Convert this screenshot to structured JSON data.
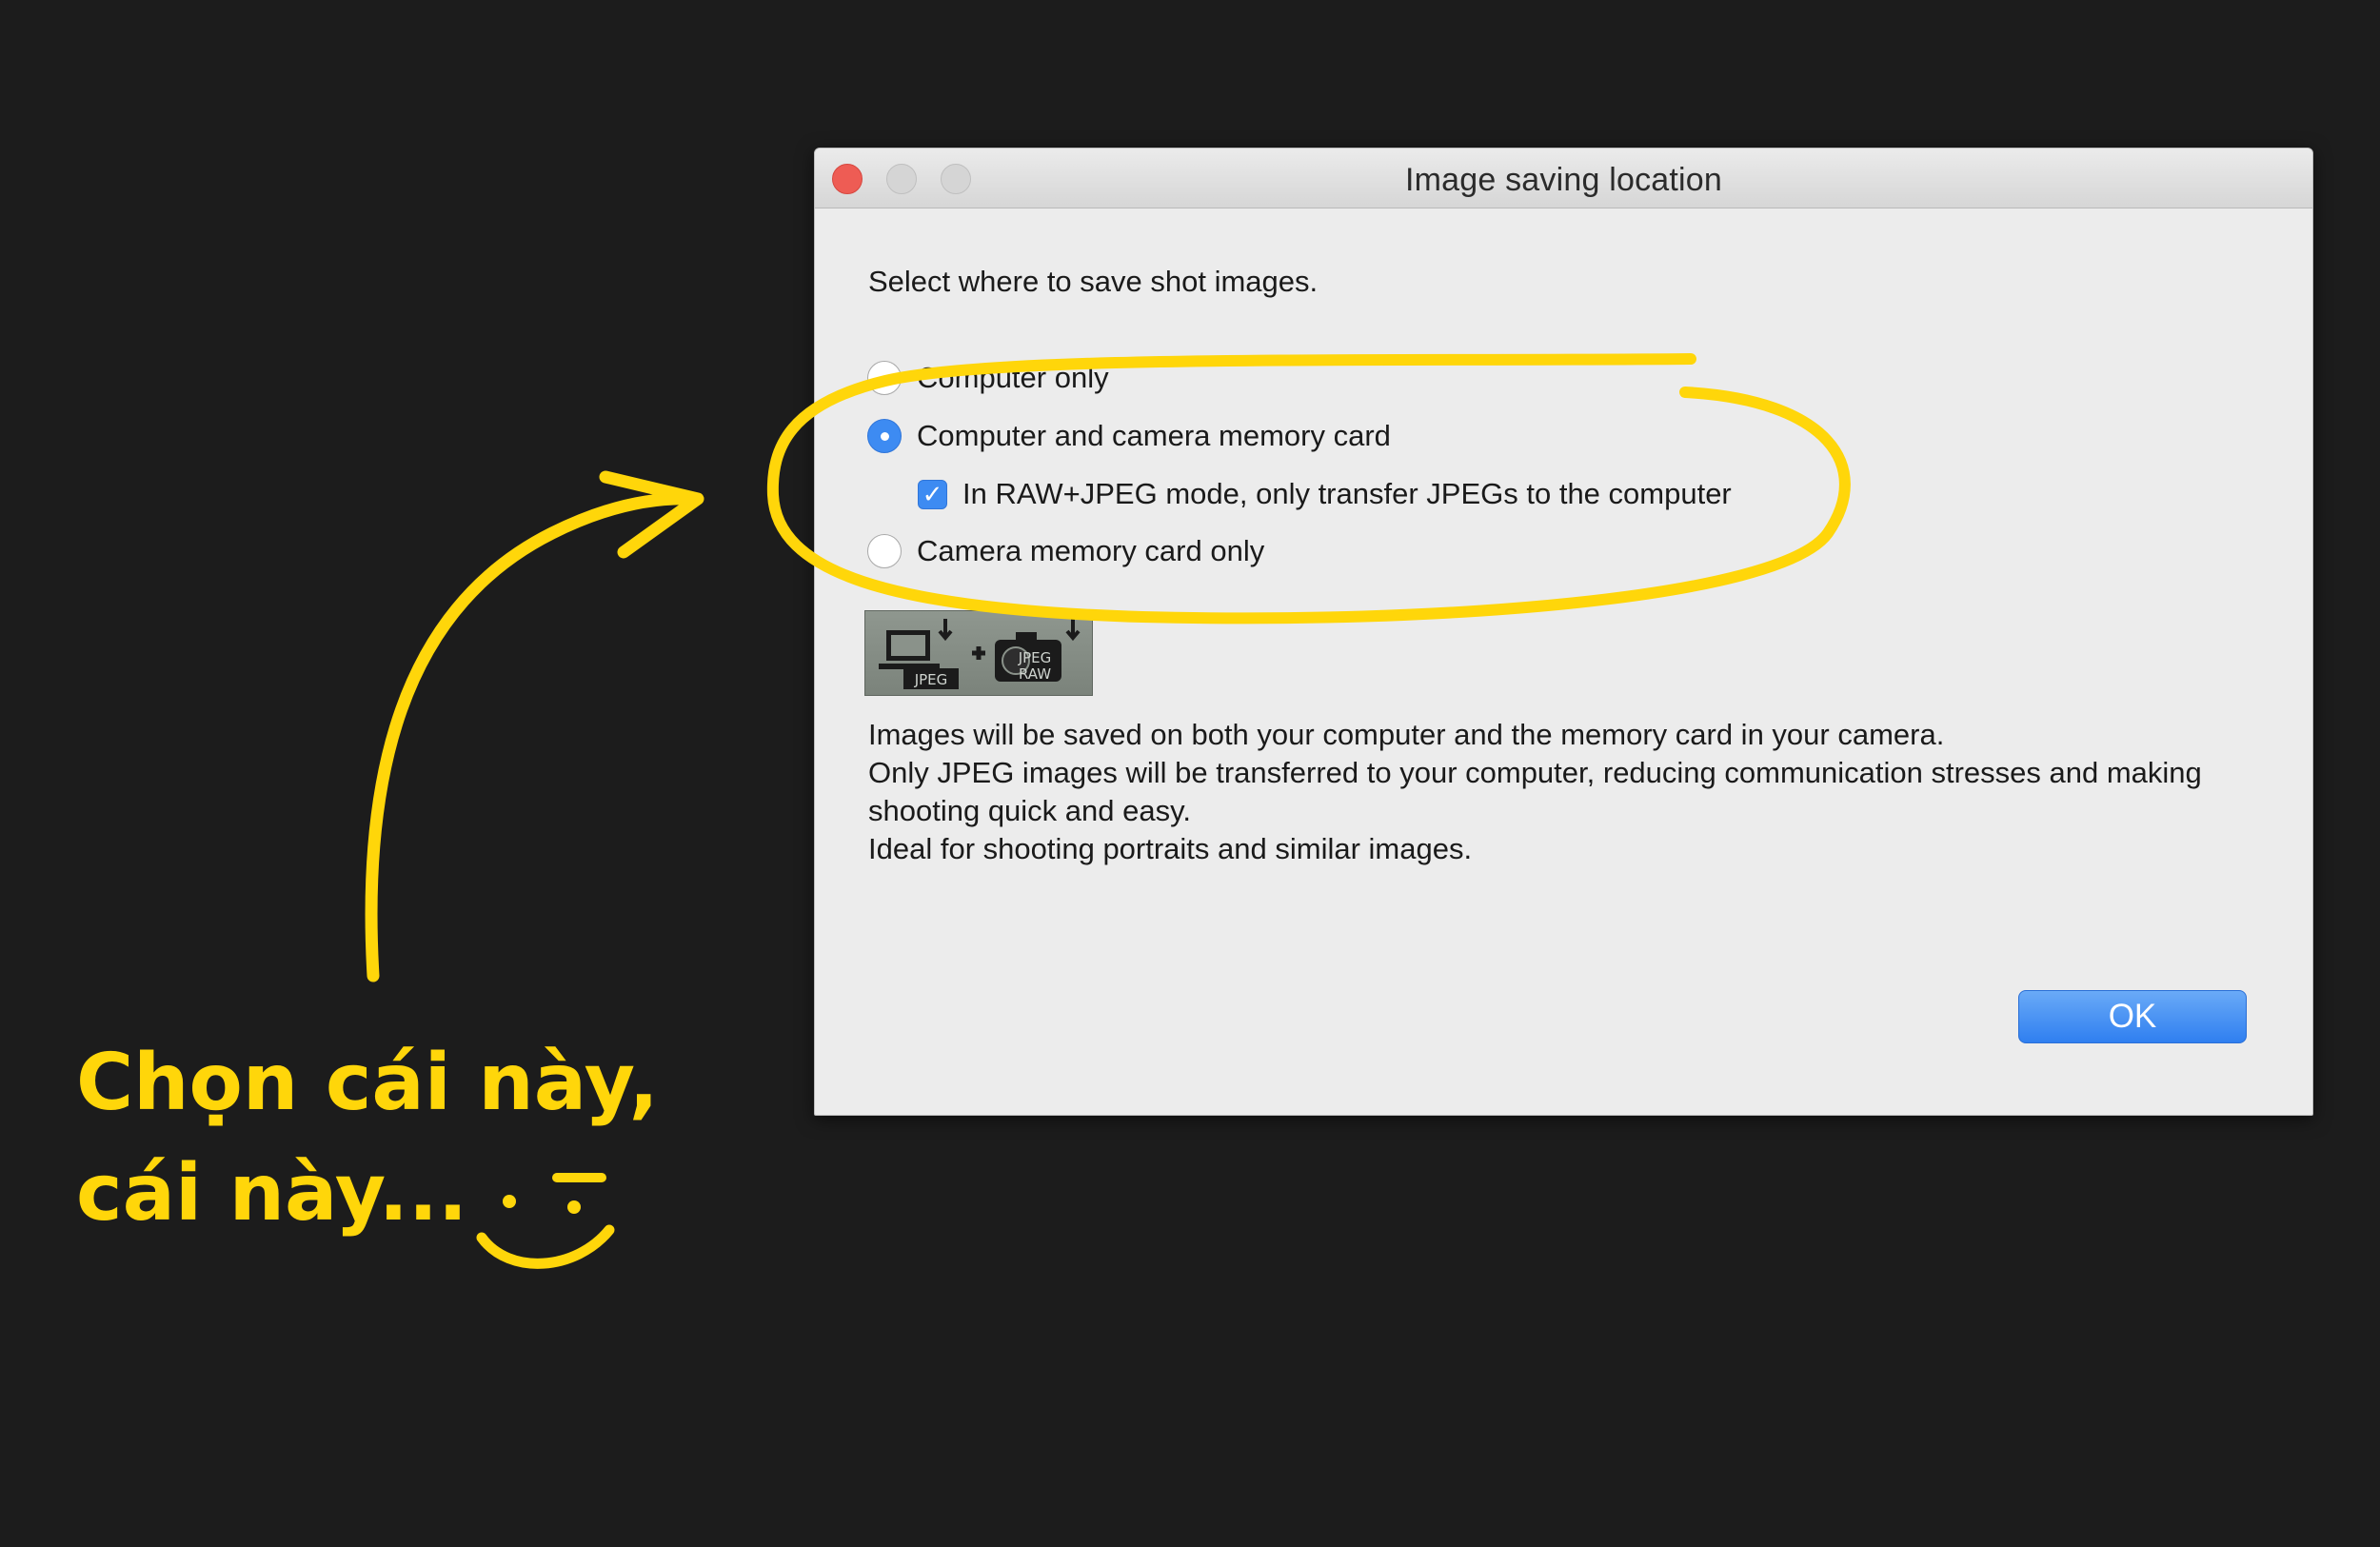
{
  "window": {
    "title": "Image saving location"
  },
  "dialog": {
    "prompt": "Select where to save shot images.",
    "options": [
      {
        "label": "Computer only",
        "selected": false
      },
      {
        "label": "Computer and camera memory card",
        "selected": true
      },
      {
        "label": "Camera memory card only",
        "selected": false
      }
    ],
    "raw_jpeg_checkbox": {
      "label": "In RAW+JPEG mode, only transfer JPEGs to the computer",
      "checked": true
    },
    "mode_icon": {
      "computer_tag": "JPEG",
      "camera_tags": [
        "JPEG",
        "RAW"
      ]
    },
    "description": [
      "Images will be saved on both your computer and the memory card in your camera.",
      "Only JPEG images will be transferred to your computer, reducing communication stresses and making shooting quick and easy.",
      "Ideal for shooting portraits and similar images."
    ],
    "ok_label": "OK"
  },
  "annotation": {
    "caption_line1": "Chọn cái này,",
    "caption_line2": "cái này...",
    "color": "#ffd60a",
    "icons": [
      "curved-arrow-icon",
      "highlight-circle-icon",
      "smirk-face-icon"
    ]
  },
  "colors": {
    "background": "#1c1c1c",
    "dialog": "#ececec",
    "accent": "#3d8bf2",
    "close": "#ee5c54"
  }
}
